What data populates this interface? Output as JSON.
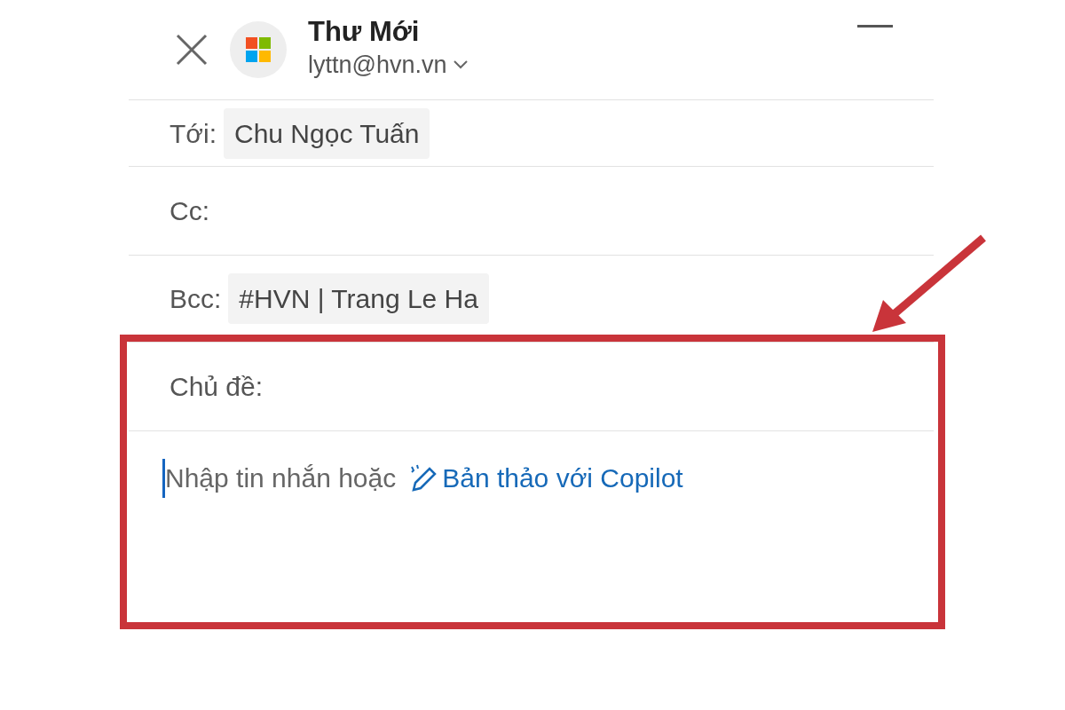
{
  "header": {
    "title": "Thư Mới",
    "account": "lyttn@hvn.vn"
  },
  "fields": [
    {
      "label": "Tới:",
      "recipients": [
        "Chu Ngọc Tuấn"
      ]
    },
    {
      "label": "Cc:"
    },
    {
      "label": "Bcc:",
      "recipients": [
        "#HVN | Trang Le Ha"
      ]
    },
    {
      "label": "Chủ đề:"
    }
  ],
  "body": {
    "placeholder": "Nhập tin nhắn hoặc",
    "copilot_link": "Bản thảo với Copilot"
  }
}
